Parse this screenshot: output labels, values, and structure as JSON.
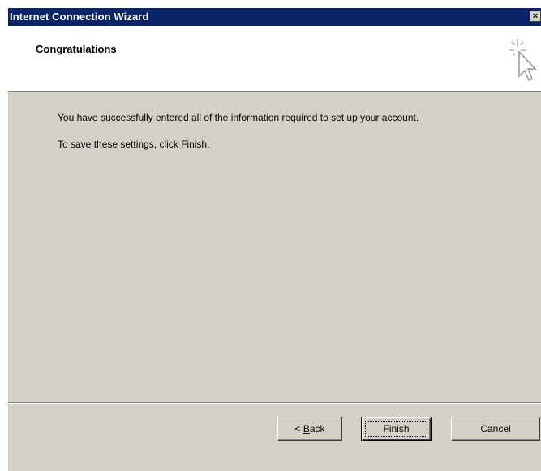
{
  "window": {
    "title": "Internet Connection Wizard",
    "close_glyph": "×"
  },
  "header": {
    "title": "Congratulations",
    "icon": "wizard-cursor-sparkle-icon"
  },
  "body": {
    "line1": "You have successfully entered all of the information required to set up your account.",
    "line2": "To save these settings, click Finish."
  },
  "buttons": {
    "back_prefix": "< ",
    "back_accel": "B",
    "back_rest": "ack",
    "finish": "Finish",
    "cancel": "Cancel"
  },
  "colors": {
    "titlebar": "#0a246a",
    "dialog_face": "#d4d0c8",
    "header_bg": "#ffffff"
  }
}
